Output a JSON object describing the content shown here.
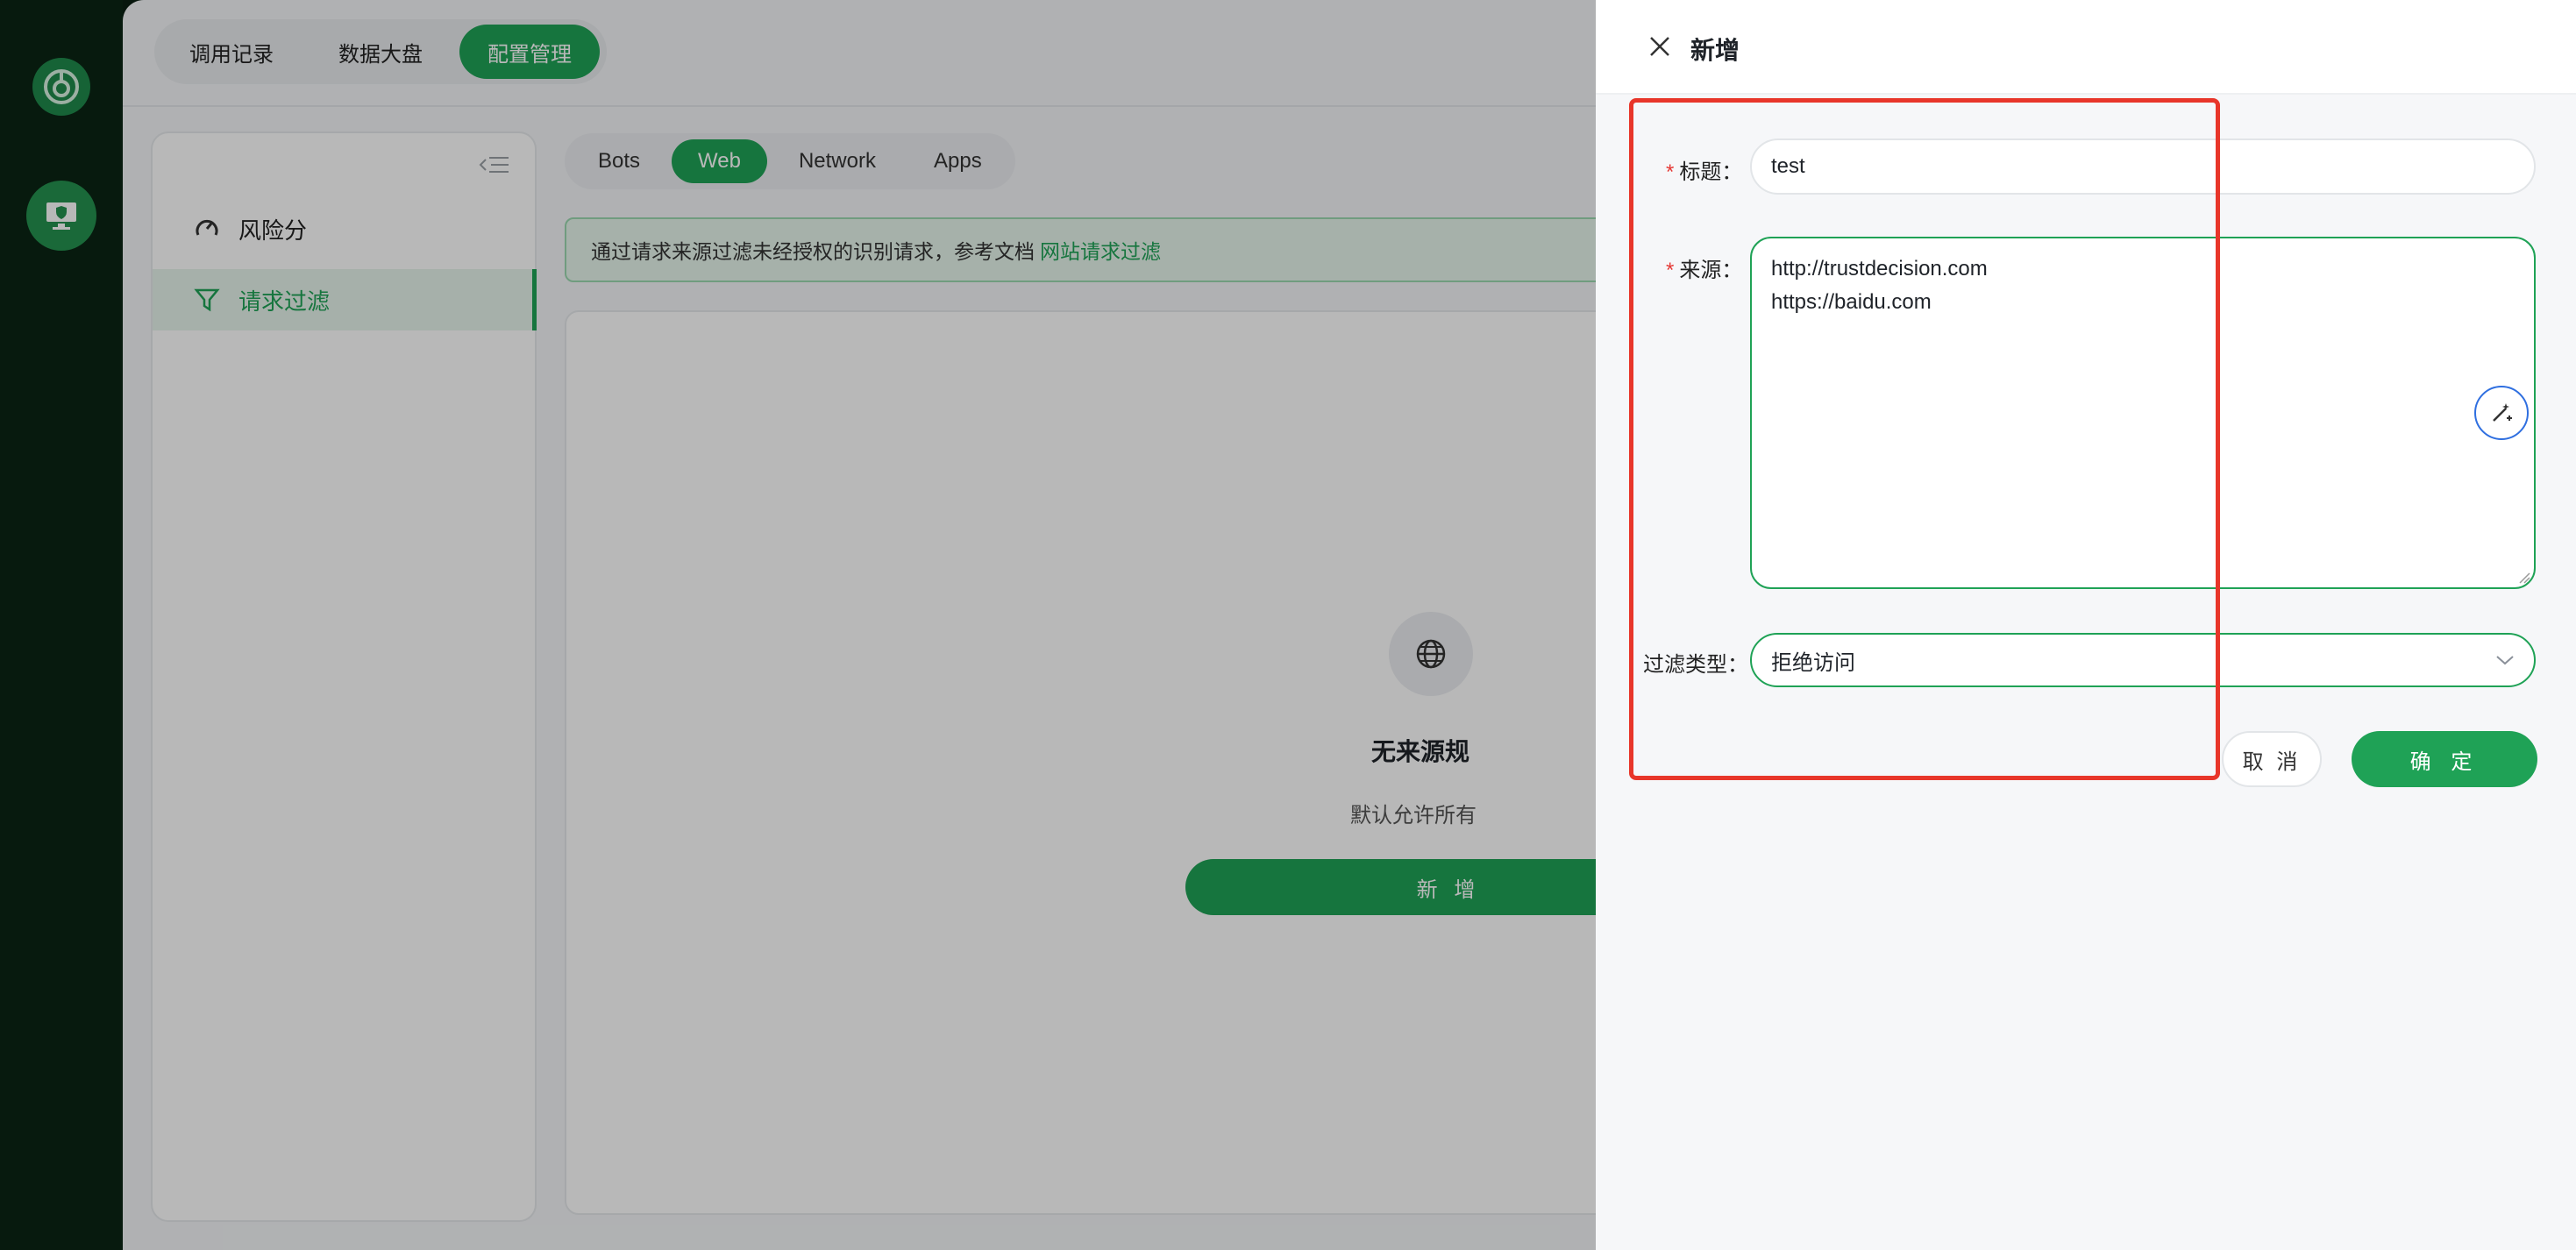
{
  "topbar": {
    "tabs": [
      {
        "label": "调用记录"
      },
      {
        "label": "数据大盘"
      },
      {
        "label": "配置管理"
      }
    ]
  },
  "sidebar": {
    "items": [
      {
        "label": "风险分",
        "icon": "gauge-icon"
      },
      {
        "label": "请求过滤",
        "icon": "filter-icon"
      }
    ]
  },
  "subtabs": [
    "Bots",
    "Web",
    "Network",
    "Apps"
  ],
  "banner": {
    "text": "通过请求来源过滤未经授权的识别请求，参考文档",
    "link": "网站请求过滤"
  },
  "empty_state": {
    "title": "无来源规",
    "desc": "默认允许所有",
    "button": "新 增"
  },
  "drawer": {
    "title": "新增",
    "fields": {
      "title_label": "标题：",
      "title_value": "test",
      "source_label": "来源：",
      "source_lines": [
        "http://trustdecision.com",
        "https://baidu.com"
      ],
      "type_label": "过滤类型：",
      "type_value": "拒绝访问"
    },
    "cancel": "取 消",
    "ok": "确 定"
  },
  "colors": {
    "brand": "#1fa256",
    "highlight_box": "#e8362a",
    "required": "#e53935"
  }
}
